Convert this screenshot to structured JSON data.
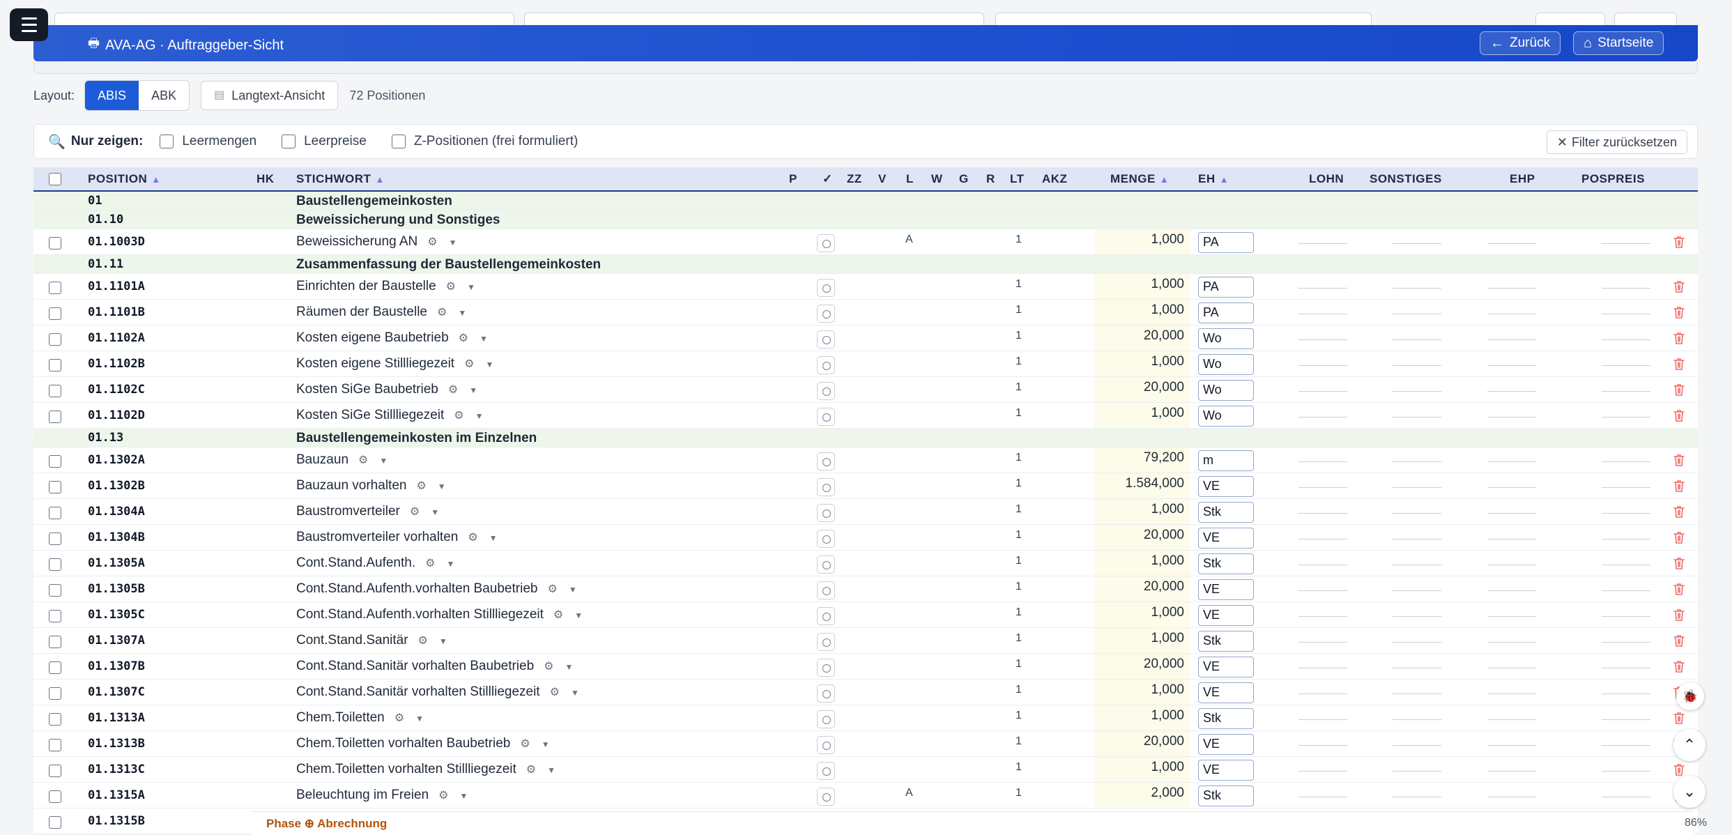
{
  "app": {
    "title": "AVA-AG · Auftraggeber-Sicht",
    "back_label": "Zurück",
    "home_label": "Startseite"
  },
  "toolbar": {
    "layout_label": "Layout:",
    "layout_options": [
      "ABIS",
      "ABK"
    ],
    "layout_selected": "ABIS",
    "langtext_label": "Langtext-Ansicht",
    "positions_count": "72 Positionen"
  },
  "filter": {
    "label": "Nur zeigen:",
    "options": [
      "Leermengen",
      "Leerpreise",
      "Z-Positionen (frei formuliert)"
    ],
    "reset_label": "Filter zurücksetzen"
  },
  "table": {
    "columns": {
      "position": "POSITION",
      "hk": "HK",
      "stichwort": "STICHWORT",
      "p": "P",
      "check": "✓",
      "zz": "ZZ",
      "v": "V",
      "l": "L",
      "w": "W",
      "g": "G",
      "r": "R",
      "lt": "LT",
      "akz": "AKZ",
      "menge": "MENGE",
      "eh": "EH",
      "lohn": "LOHN",
      "sonstiges": "SONSTIGES",
      "ehp": "EHP",
      "pospreis": "POSPREIS"
    },
    "rows": [
      {
        "type": "group",
        "position": "01",
        "stichwort": "Baustellengemeinkosten"
      },
      {
        "type": "group",
        "position": "01.10",
        "stichwort": "Beweissicherung und Sonstiges"
      },
      {
        "type": "item",
        "position": "01.1003D",
        "stichwort": "Beweissicherung AN",
        "l": "A",
        "lt": "1",
        "menge": "1,000",
        "eh": "PA"
      },
      {
        "type": "group",
        "position": "01.11",
        "stichwort": "Zusammenfassung der Baustellengemeinkosten"
      },
      {
        "type": "item",
        "position": "01.1101A",
        "stichwort": "Einrichten der Baustelle",
        "l": "",
        "lt": "1",
        "menge": "1,000",
        "eh": "PA"
      },
      {
        "type": "item",
        "position": "01.1101B",
        "stichwort": "Räumen der Baustelle",
        "l": "",
        "lt": "1",
        "menge": "1,000",
        "eh": "PA"
      },
      {
        "type": "item",
        "position": "01.1102A",
        "stichwort": "Kosten eigene Baubetrieb",
        "l": "",
        "lt": "1",
        "menge": "20,000",
        "eh": "Wo"
      },
      {
        "type": "item",
        "position": "01.1102B",
        "stichwort": "Kosten eigene Stillliegezeit",
        "l": "",
        "lt": "1",
        "menge": "1,000",
        "eh": "Wo"
      },
      {
        "type": "item",
        "position": "01.1102C",
        "stichwort": "Kosten SiGe Baubetrieb",
        "l": "",
        "lt": "1",
        "menge": "20,000",
        "eh": "Wo"
      },
      {
        "type": "item",
        "position": "01.1102D",
        "stichwort": "Kosten SiGe Stillliegezeit",
        "l": "",
        "lt": "1",
        "menge": "1,000",
        "eh": "Wo"
      },
      {
        "type": "group",
        "position": "01.13",
        "stichwort": "Baustellengemeinkosten im Einzelnen"
      },
      {
        "type": "item",
        "position": "01.1302A",
        "stichwort": "Bauzaun",
        "l": "",
        "lt": "1",
        "menge": "79,200",
        "eh": "m"
      },
      {
        "type": "item",
        "position": "01.1302B",
        "stichwort": "Bauzaun vorhalten",
        "l": "",
        "lt": "1",
        "menge": "1.584,000",
        "eh": "VE"
      },
      {
        "type": "item",
        "position": "01.1304A",
        "stichwort": "Baustromverteiler",
        "l": "",
        "lt": "1",
        "menge": "1,000",
        "eh": "Stk"
      },
      {
        "type": "item",
        "position": "01.1304B",
        "stichwort": "Baustromverteiler vorhalten",
        "l": "",
        "lt": "1",
        "menge": "20,000",
        "eh": "VE"
      },
      {
        "type": "item",
        "position": "01.1305A",
        "stichwort": "Cont.Stand.Aufenth.",
        "l": "",
        "lt": "1",
        "menge": "1,000",
        "eh": "Stk"
      },
      {
        "type": "item",
        "position": "01.1305B",
        "stichwort": "Cont.Stand.Aufenth.vorhalten Baubetrieb",
        "l": "",
        "lt": "1",
        "menge": "20,000",
        "eh": "VE"
      },
      {
        "type": "item",
        "position": "01.1305C",
        "stichwort": "Cont.Stand.Aufenth.vorhalten Stillliegezeit",
        "l": "",
        "lt": "1",
        "menge": "1,000",
        "eh": "VE"
      },
      {
        "type": "item",
        "position": "01.1307A",
        "stichwort": "Cont.Stand.Sanitär",
        "l": "",
        "lt": "1",
        "menge": "1,000",
        "eh": "Stk"
      },
      {
        "type": "item",
        "position": "01.1307B",
        "stichwort": "Cont.Stand.Sanitär vorhalten Baubetrieb",
        "l": "",
        "lt": "1",
        "menge": "20,000",
        "eh": "VE"
      },
      {
        "type": "item",
        "position": "01.1307C",
        "stichwort": "Cont.Stand.Sanitär vorhalten Stillliegezeit",
        "l": "",
        "lt": "1",
        "menge": "1,000",
        "eh": "VE"
      },
      {
        "type": "item",
        "position": "01.1313A",
        "stichwort": "Chem.Toiletten",
        "l": "",
        "lt": "1",
        "menge": "1,000",
        "eh": "Stk"
      },
      {
        "type": "item",
        "position": "01.1313B",
        "stichwort": "Chem.Toiletten vorhalten Baubetrieb",
        "l": "",
        "lt": "1",
        "menge": "20,000",
        "eh": "VE"
      },
      {
        "type": "item",
        "position": "01.1313C",
        "stichwort": "Chem.Toiletten vorhalten Stillliegezeit",
        "l": "",
        "lt": "1",
        "menge": "1,000",
        "eh": "VE"
      },
      {
        "type": "item",
        "position": "01.1315A",
        "stichwort": "Beleuchtung im Freien",
        "l": "A",
        "lt": "1",
        "menge": "2,000",
        "eh": "Stk"
      },
      {
        "type": "item",
        "position": "01.1315B",
        "stichwort": "",
        "l": "",
        "lt": "",
        "menge": "",
        "eh": ""
      }
    ]
  },
  "footer": {
    "phase": "Phase ⊕ Abrechnung",
    "zoom": "86%"
  },
  "colors": {
    "banner": "#1d4fd0",
    "accent": "#1d5bd8",
    "group_row": "#eef5ea",
    "menge_bg": "#fdfbe9",
    "trash": "#ef4444"
  },
  "icons": [
    "menu-icon",
    "printer-icon",
    "arrow-left-icon",
    "home-icon",
    "document-icon",
    "search-icon",
    "close-icon",
    "sort-icon",
    "settings-icon",
    "chevron-down-icon",
    "trash-icon",
    "bug-icon",
    "chevron-up-icon"
  ]
}
